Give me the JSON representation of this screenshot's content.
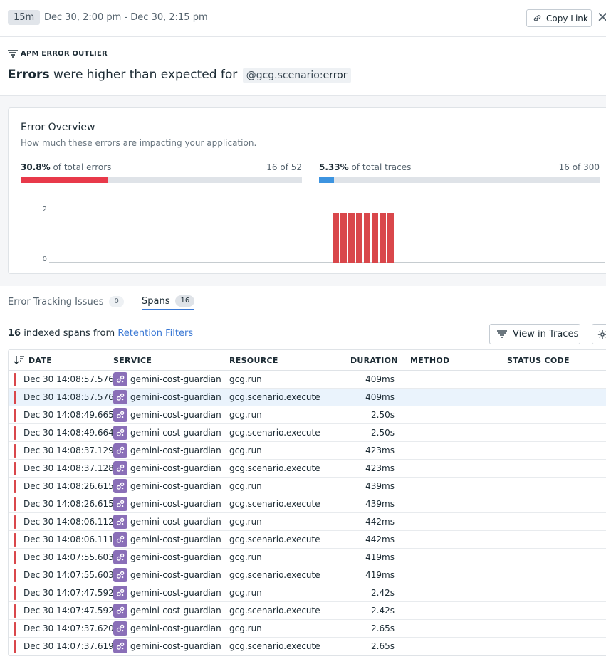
{
  "header": {
    "time_pill": "15m",
    "time_range": "Dec 30, 2:00 pm - Dec 30, 2:15 pm",
    "copy_link": "Copy Link"
  },
  "section_label": "APM ERROR OUTLIER",
  "headline": {
    "bold": "Errors",
    "text": "were higher than expected for",
    "tag_key": "@gcg.scenario:",
    "tag_value": "error"
  },
  "overview": {
    "title": "Error Overview",
    "subtitle": "How much these errors are impacting your application.",
    "errors": {
      "pct": "30.8%",
      "label": "of total errors",
      "count": "16 of 52",
      "fraction": 0.308
    },
    "traces": {
      "pct": "5.33%",
      "label": "of total traces",
      "count": "16 of 300",
      "fraction": 0.0533
    }
  },
  "chart_data": {
    "type": "bar",
    "y_ticks": [
      "2",
      "0"
    ],
    "ylim": [
      0,
      2
    ],
    "bar_color": "#d9474b",
    "bars_index": [
      0,
      1,
      2,
      3,
      4,
      5,
      6,
      7
    ],
    "values": [
      2,
      2,
      2,
      2,
      2,
      2,
      2,
      2
    ]
  },
  "tabs": [
    {
      "label": "Error Tracking Issues",
      "count": "0"
    },
    {
      "label": "Spans",
      "count": "16"
    }
  ],
  "spans": {
    "count": "16",
    "text": "indexed spans from",
    "link": "Retention Filters",
    "view_traces": "View in Traces"
  },
  "columns": [
    "DATE",
    "SERVICE",
    "RESOURCE",
    "DURATION",
    "METHOD",
    "STATUS CODE"
  ],
  "rows": [
    {
      "date": "Dec 30 14:08:57.576",
      "service": "gemini-cost-guardian",
      "resource": "gcg.run",
      "duration": "409ms"
    },
    {
      "date": "Dec 30 14:08:57.576",
      "service": "gemini-cost-guardian",
      "resource": "gcg.scenario.execute",
      "duration": "409ms"
    },
    {
      "date": "Dec 30 14:08:49.665",
      "service": "gemini-cost-guardian",
      "resource": "gcg.run",
      "duration": "2.50s"
    },
    {
      "date": "Dec 30 14:08:49.664",
      "service": "gemini-cost-guardian",
      "resource": "gcg.scenario.execute",
      "duration": "2.50s"
    },
    {
      "date": "Dec 30 14:08:37.129",
      "service": "gemini-cost-guardian",
      "resource": "gcg.run",
      "duration": "423ms"
    },
    {
      "date": "Dec 30 14:08:37.128",
      "service": "gemini-cost-guardian",
      "resource": "gcg.scenario.execute",
      "duration": "423ms"
    },
    {
      "date": "Dec 30 14:08:26.615",
      "service": "gemini-cost-guardian",
      "resource": "gcg.run",
      "duration": "439ms"
    },
    {
      "date": "Dec 30 14:08:26.615",
      "service": "gemini-cost-guardian",
      "resource": "gcg.scenario.execute",
      "duration": "439ms"
    },
    {
      "date": "Dec 30 14:08:06.112",
      "service": "gemini-cost-guardian",
      "resource": "gcg.run",
      "duration": "442ms"
    },
    {
      "date": "Dec 30 14:08:06.111",
      "service": "gemini-cost-guardian",
      "resource": "gcg.scenario.execute",
      "duration": "442ms"
    },
    {
      "date": "Dec 30 14:07:55.603",
      "service": "gemini-cost-guardian",
      "resource": "gcg.run",
      "duration": "419ms"
    },
    {
      "date": "Dec 30 14:07:55.603",
      "service": "gemini-cost-guardian",
      "resource": "gcg.scenario.execute",
      "duration": "419ms"
    },
    {
      "date": "Dec 30 14:07:47.592",
      "service": "gemini-cost-guardian",
      "resource": "gcg.run",
      "duration": "2.42s"
    },
    {
      "date": "Dec 30 14:07:47.592",
      "service": "gemini-cost-guardian",
      "resource": "gcg.scenario.execute",
      "duration": "2.42s"
    },
    {
      "date": "Dec 30 14:07:37.620",
      "service": "gemini-cost-guardian",
      "resource": "gcg.run",
      "duration": "2.65s"
    },
    {
      "date": "Dec 30 14:07:37.619",
      "service": "gemini-cost-guardian",
      "resource": "gcg.scenario.execute",
      "duration": "2.65s"
    }
  ],
  "icons": [
    "link-icon",
    "close-icon",
    "filter-lines-icon",
    "sort-icon",
    "view-list-icon",
    "gear-icon",
    "service-gears-icon"
  ],
  "colors": {
    "error": "#e8394a",
    "traces": "#3d94e0",
    "link": "#3a78d4",
    "service_icon": "#8a6fb8",
    "selected_row": "#eaf3fc"
  }
}
